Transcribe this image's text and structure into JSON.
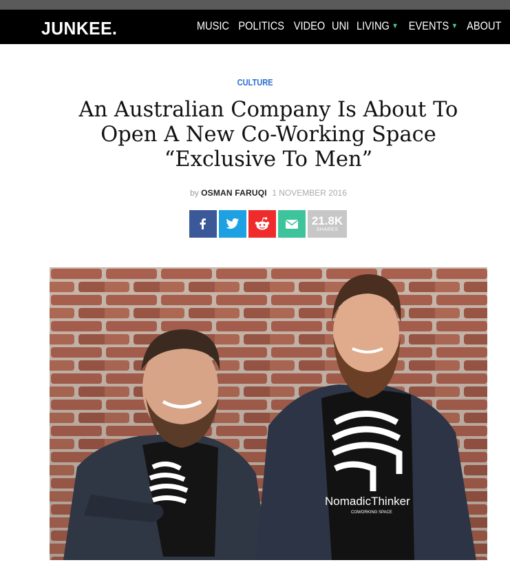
{
  "header": {
    "logo": "JUNKEE.",
    "nav": [
      {
        "label": "MUSIC",
        "dropdown": false
      },
      {
        "label": "POLITICS",
        "dropdown": false
      },
      {
        "label": "VIDEO",
        "dropdown": false
      },
      {
        "label": "UNI",
        "dropdown": false
      },
      {
        "label": "LIVING",
        "dropdown": true
      },
      {
        "label": "EVENTS",
        "dropdown": true
      },
      {
        "label": "ABOUT",
        "dropdown": false
      }
    ]
  },
  "article": {
    "category": "CULTURE",
    "title_lines": [
      "An Australian Company Is About To",
      "Open A New Co-Working Space",
      "“Exclusive To Men”"
    ],
    "byline": {
      "by": "by",
      "author": "OSMAN FARUQI",
      "date": "1 NOVEMBER 2016"
    },
    "share": {
      "buttons": [
        {
          "name": "facebook",
          "icon": "facebook-icon",
          "color": "#3b5998"
        },
        {
          "name": "twitter",
          "icon": "twitter-icon",
          "color": "#1da1e2"
        },
        {
          "name": "reddit",
          "icon": "reddit-icon",
          "color": "#f02b2b"
        },
        {
          "name": "email",
          "icon": "email-icon",
          "color": "#3ec49a"
        }
      ],
      "count": "21.8K",
      "count_label": "SHARES"
    },
    "hero_image": {
      "shirt_text": "NomadicThinker",
      "shirt_subtext": "COWORKING SPACE"
    }
  },
  "colors": {
    "accent": "#2a6fd1",
    "nav_caret": "#3fcf8e",
    "navbar": "#000000"
  }
}
